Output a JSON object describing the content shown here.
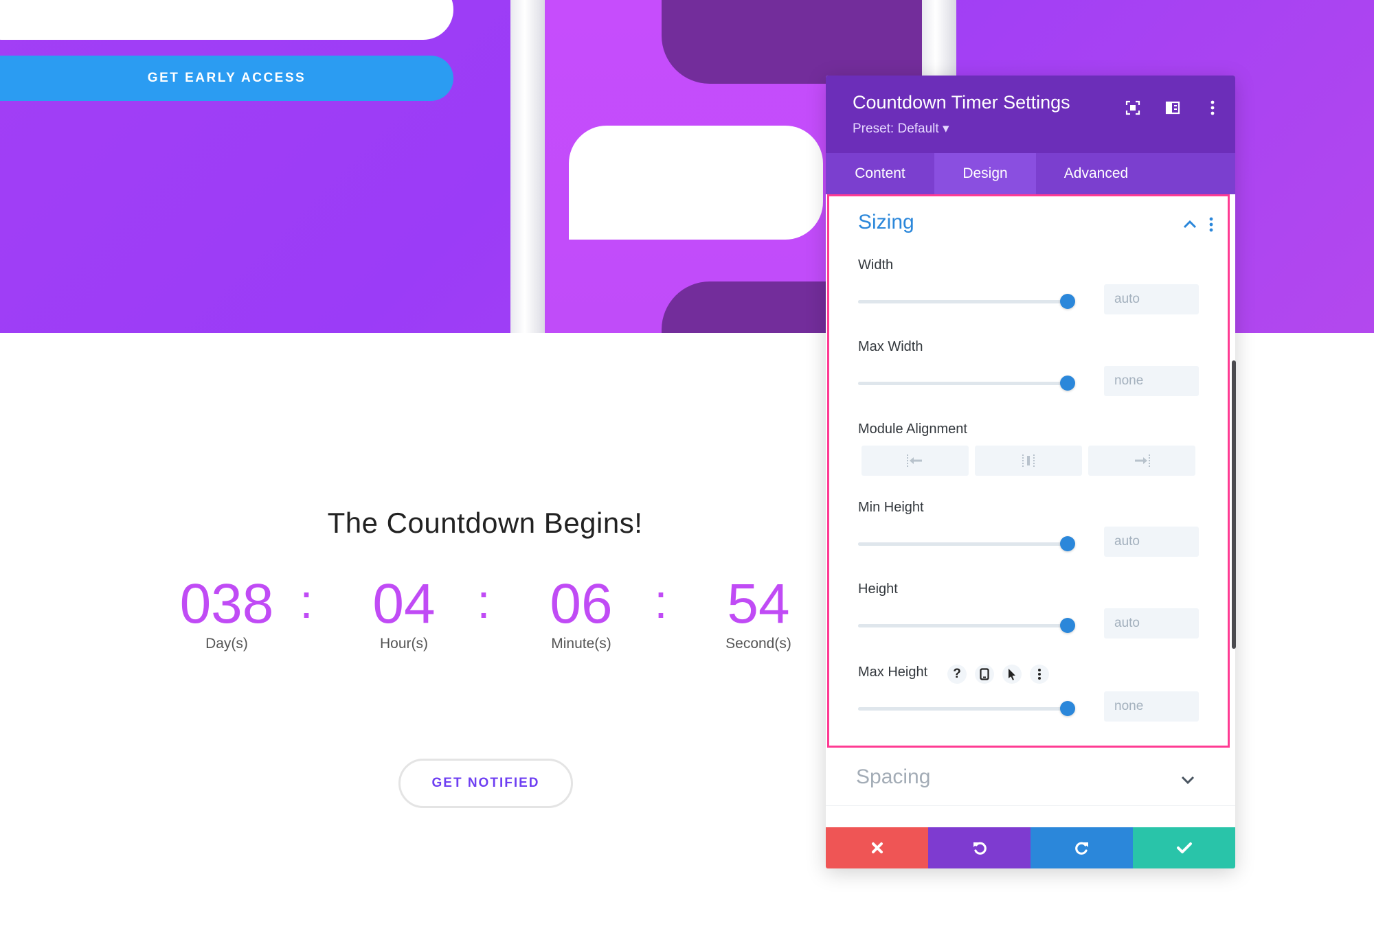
{
  "hero": {
    "cta_label": "GET EARLY ACCESS"
  },
  "countdown": {
    "headline": "The Countdown Begins!",
    "units": [
      {
        "value": "038",
        "label": "Day(s)"
      },
      {
        "value": "04",
        "label": "Hour(s)"
      },
      {
        "value": "06",
        "label": "Minute(s)"
      },
      {
        "value": "54",
        "label": "Second(s)"
      }
    ],
    "separator": ":",
    "notify_label": "GET NOTIFIED",
    "accent_color": "#c04bf5"
  },
  "panel": {
    "title": "Countdown Timer Settings",
    "preset": "Preset: Default ▾",
    "header_icons": [
      "focus-icon",
      "split-view-icon",
      "more-vertical-icon"
    ],
    "tabs": [
      {
        "label": "Content",
        "active": false
      },
      {
        "label": "Design",
        "active": true
      },
      {
        "label": "Advanced",
        "active": false
      }
    ],
    "sizing": {
      "title": "Sizing",
      "fields": {
        "width": {
          "label": "Width",
          "value": "auto",
          "level": 1.0
        },
        "max_width": {
          "label": "Max Width",
          "value": "none",
          "level": 1.0
        },
        "module_alignment": {
          "label": "Module Alignment",
          "options": [
            "align-left-icon",
            "align-center-icon",
            "align-right-icon"
          ]
        },
        "min_height": {
          "label": "Min Height",
          "value": "auto",
          "level": 1.0
        },
        "height": {
          "label": "Height",
          "value": "auto",
          "level": 1.0
        },
        "max_height": {
          "label": "Max Height",
          "value": "none",
          "level": 1.0,
          "help": "?"
        }
      }
    },
    "spacing": {
      "title": "Spacing"
    },
    "footer": {
      "cancel_color": "#ef5555",
      "undo_color": "#7e3bd0",
      "redo_color": "#2b87da",
      "save_color": "#29c4a9"
    }
  }
}
